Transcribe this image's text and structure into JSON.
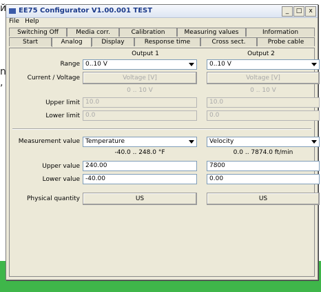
{
  "stray_text": [
    {
      "text": "й"
    },
    {
      "text": "n"
    },
    {
      "text": ","
    },
    {
      "text": "."
    }
  ],
  "window": {
    "title": "EE75 Configurator V1.00.001 TEST",
    "controls": {
      "minimize": "_",
      "maximize": "□",
      "close": "x"
    }
  },
  "menu": {
    "file": "File",
    "help": "Help"
  },
  "tabs_top": [
    "Switching Off",
    "Media corr.",
    "Calibration",
    "Measuring values",
    "Information"
  ],
  "tabs_bottom": [
    "Start",
    "Analog",
    "Display",
    "Response time",
    "Cross sect.",
    "Probe cable"
  ],
  "active_tab": "Analog",
  "analog": {
    "output1_header": "Output 1",
    "output2_header": "Output 2",
    "labels": {
      "range": "Range",
      "current_voltage": "Current / Voltage",
      "upper_limit": "Upper limit",
      "lower_limit": "Lower limit",
      "measurement_value": "Measurement value",
      "upper_value": "Upper value",
      "lower_value": "Lower value",
      "physical_quantity": "Physical quantity"
    },
    "output1": {
      "range": "0..10 V",
      "mode_button": "Voltage [V]",
      "range_hint": "0 .. 10 V",
      "upper_limit": "10.0",
      "lower_limit": "0.0",
      "measurement": "Temperature",
      "measurement_hint": "-40.0 .. 248.0 °F",
      "upper_value": "240.00",
      "lower_value": "-40.00",
      "physical_quantity": "US"
    },
    "output2": {
      "range": "0..10 V",
      "mode_button": "Voltage [V]",
      "range_hint": "0 .. 10 V",
      "upper_limit": "10.0",
      "lower_limit": "0.0",
      "measurement": "Velocity",
      "measurement_hint": "0.0 .. 7874.0 ft/min",
      "upper_value": "7800",
      "lower_value": "0.00",
      "physical_quantity": "US"
    }
  },
  "colors": {
    "window_bg": "#ece9d8",
    "title_text": "#1b3a8a",
    "bottom_bar": "#3fb64a"
  }
}
